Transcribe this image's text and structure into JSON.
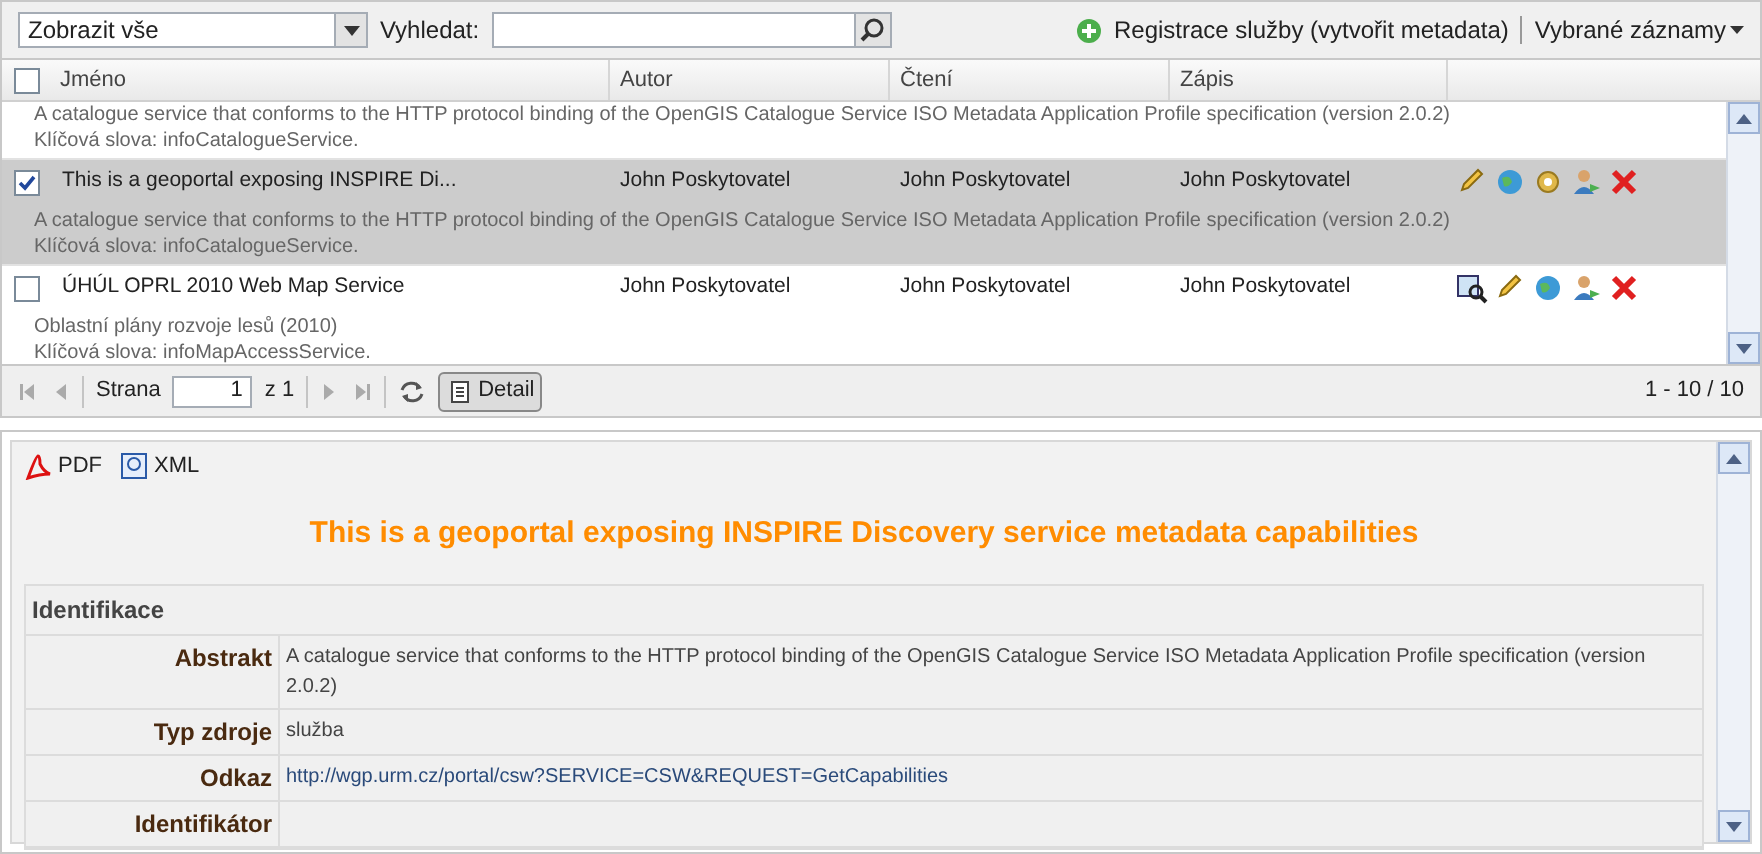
{
  "toolbar": {
    "filter": "Zobrazit vše",
    "search_label": "Vyhledat:",
    "register": "Registrace služby (vytvořit metadata)",
    "selected_menu": "Vybrané záznamy"
  },
  "columns": [
    "Jméno",
    "Autor",
    "Čtení",
    "Zápis"
  ],
  "header_checked": false,
  "rows": [
    {
      "partial": true,
      "lines": [
        "A catalogue service that conforms to the HTTP protocol binding of the OpenGIS Catalogue Service ISO Metadata Application Profile specification (version 2.0.2)",
        "Klíčová slova: infoCatalogueService."
      ]
    },
    {
      "partial": false,
      "selected": true,
      "checked": true,
      "title": "This is a geoportal exposing INSPIRE Di...",
      "author": "John Poskytovatel",
      "read": "John Poskytovatel",
      "write": "John Poskytovatel",
      "actions": [
        {
          "kind": "edit"
        },
        {
          "kind": "globe"
        },
        {
          "kind": "settings"
        },
        {
          "kind": "user"
        },
        {
          "kind": "delete"
        }
      ],
      "lines": [
        "A catalogue service that conforms to the HTTP protocol binding of the OpenGIS Catalogue Service ISO Metadata Application Profile specification (version 2.0.2)",
        "Klíčová slova: infoCatalogueService."
      ]
    },
    {
      "partial": false,
      "selected": false,
      "checked": false,
      "title": "ÚHÚL OPRL 2010 Web Map Service",
      "author": "John Poskytovatel",
      "read": "John Poskytovatel",
      "write": "John Poskytovatel",
      "actions": [
        {
          "kind": "preview"
        },
        {
          "kind": "edit"
        },
        {
          "kind": "globe"
        },
        {
          "kind": "user"
        },
        {
          "kind": "delete"
        }
      ],
      "lines": [
        "Oblastní plány rozvoje lesů (2010)",
        "Klíčová slova: infoMapAccessService."
      ]
    }
  ],
  "paging": {
    "page_label": "Strana",
    "page": "1",
    "of": "z 1",
    "detail": "Detail",
    "range": "1 - 10 / 10"
  },
  "detail": {
    "pdf": "PDF",
    "xml": "XML",
    "title": "This is a geoportal exposing INSPIRE Discovery service metadata capabilities",
    "section": "Identifikace",
    "fields": [
      {
        "kind": "text",
        "label": "Abstrakt",
        "value": "A catalogue service that conforms to the HTTP protocol binding of the OpenGIS Catalogue Service ISO Metadata Application Profile specification (version 2.0.2)"
      },
      {
        "kind": "text",
        "label": "Typ zdroje",
        "value": "služba"
      },
      {
        "kind": "link",
        "label": "Odkaz",
        "value": "http://wgp.urm.cz/portal/csw?SERVICE=CSW&REQUEST=GetCapabilities"
      },
      {
        "kind": "text",
        "label": "Identifikátor"
      }
    ]
  }
}
